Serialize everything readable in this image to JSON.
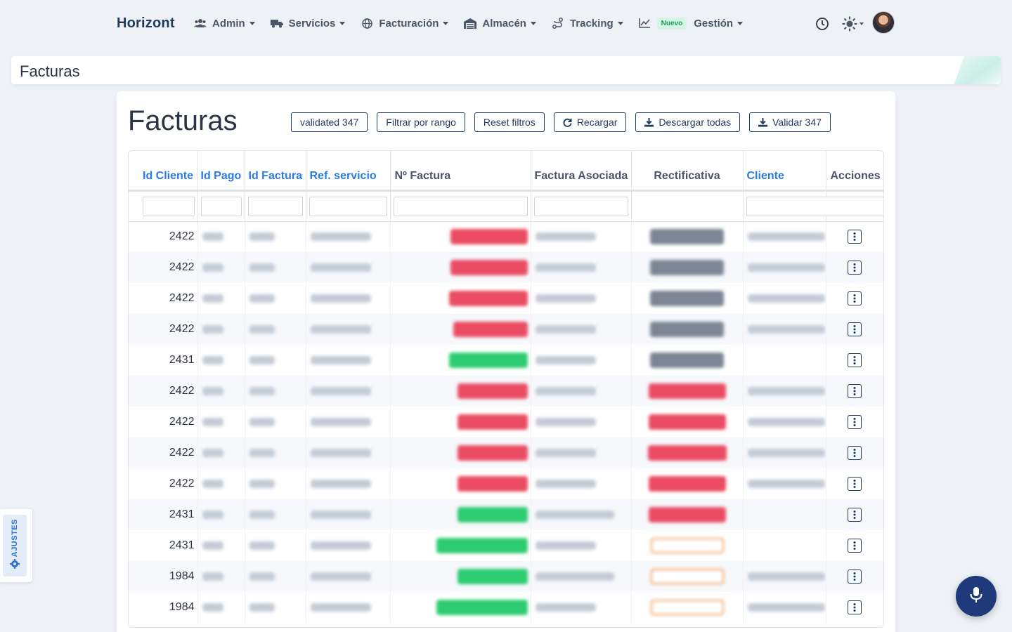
{
  "nav": {
    "brand": "Horizont",
    "items": [
      {
        "label": "Admin",
        "icon": "users-icon"
      },
      {
        "label": "Servicios",
        "icon": "truck-icon"
      },
      {
        "label": "Facturación",
        "icon": "globe-icon"
      },
      {
        "label": "Almacén",
        "icon": "warehouse-icon"
      },
      {
        "label": "Tracking",
        "icon": "route-icon"
      }
    ],
    "new_badge": "Nuevo",
    "gestion": "Gestión"
  },
  "titlebar": {
    "title": "Facturas"
  },
  "card": {
    "heading": "Facturas",
    "buttons": {
      "validated": "validated 347",
      "filter_range": "Filtrar por rango",
      "reset": "Reset filtros",
      "reload": "Recargar",
      "download_all": "Descargar todas",
      "validate": "Validar 347"
    }
  },
  "table": {
    "columns": [
      "Id Cliente",
      "Id Pago",
      "Id Factura",
      "Ref. servicio",
      "Nº Factura",
      "Factura Asociada",
      "Rectificativa",
      "Cliente",
      "Acciones"
    ],
    "rows": [
      {
        "id_cliente": "2422"
      },
      {
        "id_cliente": "2422"
      },
      {
        "id_cliente": "2422"
      },
      {
        "id_cliente": "2422"
      },
      {
        "id_cliente": "2431"
      },
      {
        "id_cliente": "2422"
      },
      {
        "id_cliente": "2422"
      },
      {
        "id_cliente": "2422"
      },
      {
        "id_cliente": "2422"
      },
      {
        "id_cliente": "2431"
      },
      {
        "id_cliente": "2431"
      },
      {
        "id_cliente": "1984"
      },
      {
        "id_cliente": "1984"
      }
    ]
  },
  "side_tab": {
    "label": "AJUSTES"
  },
  "colors": {
    "primary": "#1f3a5f",
    "link": "#2c7be5",
    "danger": "#ea4c63",
    "success": "#2ecc71",
    "muted": "#7d8694",
    "warning": "#f39c5a"
  }
}
